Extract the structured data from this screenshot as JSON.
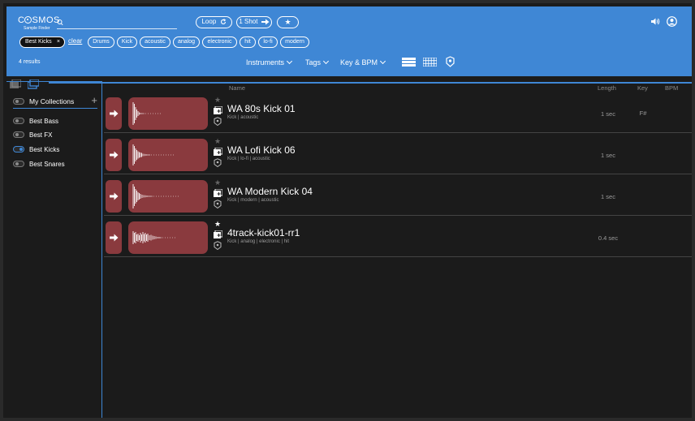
{
  "app": {
    "logo_text": "COSMOS",
    "logo_sub": "Sample Finder",
    "search_placeholder": ""
  },
  "header": {
    "buttons": {
      "loop": "Loop",
      "one_shot": "1 Shot"
    },
    "active_filter": "Best Kicks",
    "clear_label": "clear",
    "tags": [
      "Drums",
      "Kick",
      "acoustic",
      "analog",
      "electronic",
      "hit",
      "lo-fi",
      "modern"
    ],
    "results": "4 results",
    "menus": {
      "instruments": "Instruments",
      "tags": "Tags",
      "key_bpm": "Key & BPM"
    }
  },
  "sidebar": {
    "collections_title": "My Collections",
    "add_label": "+",
    "items": [
      {
        "label": "Best Bass",
        "on": false
      },
      {
        "label": "Best FX",
        "on": false
      },
      {
        "label": "Best Kicks",
        "on": true
      },
      {
        "label": "Best Snares",
        "on": false
      }
    ]
  },
  "columns": {
    "name": "Name",
    "length": "Length",
    "key": "Key",
    "bpm": "BPM"
  },
  "rows": [
    {
      "title": "WA 80s Kick 01",
      "tags": "Kick | acoustic",
      "length": "1 sec",
      "key": "F#",
      "bpm": "",
      "favorite": false
    },
    {
      "title": "WA Lofi Kick 06",
      "tags": "Kick | lo-fi | acoustic",
      "length": "1 sec",
      "key": "",
      "bpm": "",
      "favorite": false
    },
    {
      "title": "WA Modern Kick 04",
      "tags": "Kick | modern | acoustic",
      "length": "1 sec",
      "key": "",
      "bpm": "",
      "favorite": false
    },
    {
      "title": "4track-kick01-rr1",
      "tags": "Kick | analog | electronic | hit",
      "length": "0.4 sec",
      "key": "",
      "bpm": "",
      "favorite": true
    }
  ],
  "colors": {
    "header_blue": "#3f87d5",
    "row_red": "#8a3a3e",
    "background": "#1b1b1b"
  },
  "icons": [
    "search-icon",
    "loop-icon",
    "arrow-right-icon",
    "star-icon",
    "volume-icon",
    "user-icon",
    "list-view-icon",
    "grid-view-icon",
    "tag-icon",
    "play-icon",
    "add-to-collection-icon"
  ]
}
